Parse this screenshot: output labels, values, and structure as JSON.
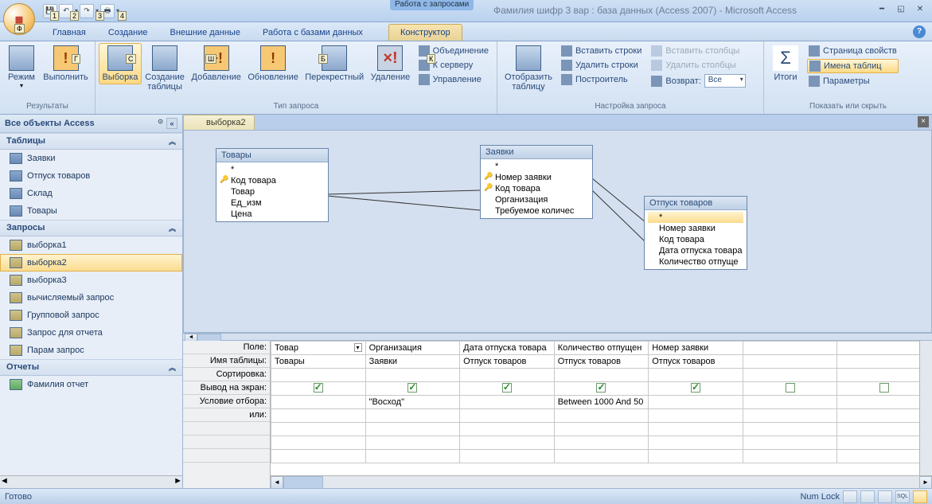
{
  "title": {
    "context_label": "Работа с запросами",
    "main": "Фамилия шифр 3 вар : база данных (Access 2007) - Microsoft Access"
  },
  "tabs": {
    "home": "Главная",
    "create": "Создание",
    "external": "Внешние данные",
    "dbtools": "Работа с базами данных",
    "designer": "Конструктор"
  },
  "ribbon": {
    "results": {
      "label": "Результаты",
      "view": "Режим",
      "run": "Выполнить"
    },
    "querytype": {
      "label": "Тип запроса",
      "select": "Выборка",
      "maketable": "Создание\nтаблицы",
      "append": "Добавление",
      "update": "Обновление",
      "crosstab": "Перекрестный",
      "delete": "Удаление",
      "union": "Объединение",
      "passthrough": "К серверу",
      "ddl": "Управление"
    },
    "setup": {
      "label": "Настройка запроса",
      "showtable": "Отобразить\nтаблицу",
      "insertrows": "Вставить строки",
      "deleterows": "Удалить строки",
      "builder": "Построитель",
      "insertcols": "Вставить столбцы",
      "deletecols": "Удалить столбцы",
      "return": "Возврат:",
      "return_val": "Все"
    },
    "showhide": {
      "label": "Показать или скрыть",
      "totals": "Итоги",
      "propsheet": "Страница свойств",
      "tablenames": "Имена таблиц",
      "params": "Параметры"
    }
  },
  "nav": {
    "header": "Все объекты Access",
    "g_tables": "Таблицы",
    "tables": [
      "Заявки",
      "Отпуск товаров",
      "Склад",
      "Товары"
    ],
    "g_queries": "Запросы",
    "queries": [
      "выборка1",
      "выборка2",
      "выборка3",
      "вычисляемый запрос",
      "Групповой запрос",
      "Запрос для отчета",
      "Парам запрос"
    ],
    "g_reports": "Отчеты",
    "reports": [
      "Фамилия отчет"
    ]
  },
  "doc": {
    "tab": "выборка2"
  },
  "tables_diagram": {
    "t1": {
      "title": "Товары",
      "fields": [
        "*",
        "Код товара",
        "Товар",
        "Ед_изм",
        "Цена"
      ],
      "keys": [
        1
      ]
    },
    "t2": {
      "title": "Заявки",
      "fields": [
        "*",
        "Номер заявки",
        "Код товара",
        "Организация",
        "Требуемое количес"
      ],
      "keys": [
        1,
        2
      ]
    },
    "t3": {
      "title": "Отпуск товаров",
      "fields": [
        "*",
        "Номер заявки",
        "Код товара",
        "Дата отпуска товара",
        "Количество отпуще"
      ],
      "keys": [],
      "sel": 0
    }
  },
  "grid": {
    "labels": {
      "field": "Поле:",
      "table": "Имя таблицы:",
      "sort": "Сортировка:",
      "show": "Вывод на экран:",
      "criteria": "Условие отбора:",
      "or": "или:"
    },
    "cols": [
      {
        "field": "Товар",
        "table": "Товары",
        "show": true,
        "criteria": ""
      },
      {
        "field": "Организация",
        "table": "Заявки",
        "show": true,
        "criteria": "\"Восход\""
      },
      {
        "field": "Дата отпуска товара",
        "table": "Отпуск товаров",
        "show": true,
        "criteria": ""
      },
      {
        "field": "Количество отпущен",
        "table": "Отпуск товаров",
        "show": true,
        "criteria": "Between 1000 And 50"
      },
      {
        "field": "Номер заявки",
        "table": "Отпуск товаров",
        "show": true,
        "criteria": ""
      },
      {
        "field": "",
        "table": "",
        "show": false,
        "criteria": ""
      },
      {
        "field": "",
        "table": "",
        "show": false,
        "criteria": ""
      }
    ]
  },
  "status": {
    "ready": "Готово",
    "numlock": "Num Lock"
  }
}
